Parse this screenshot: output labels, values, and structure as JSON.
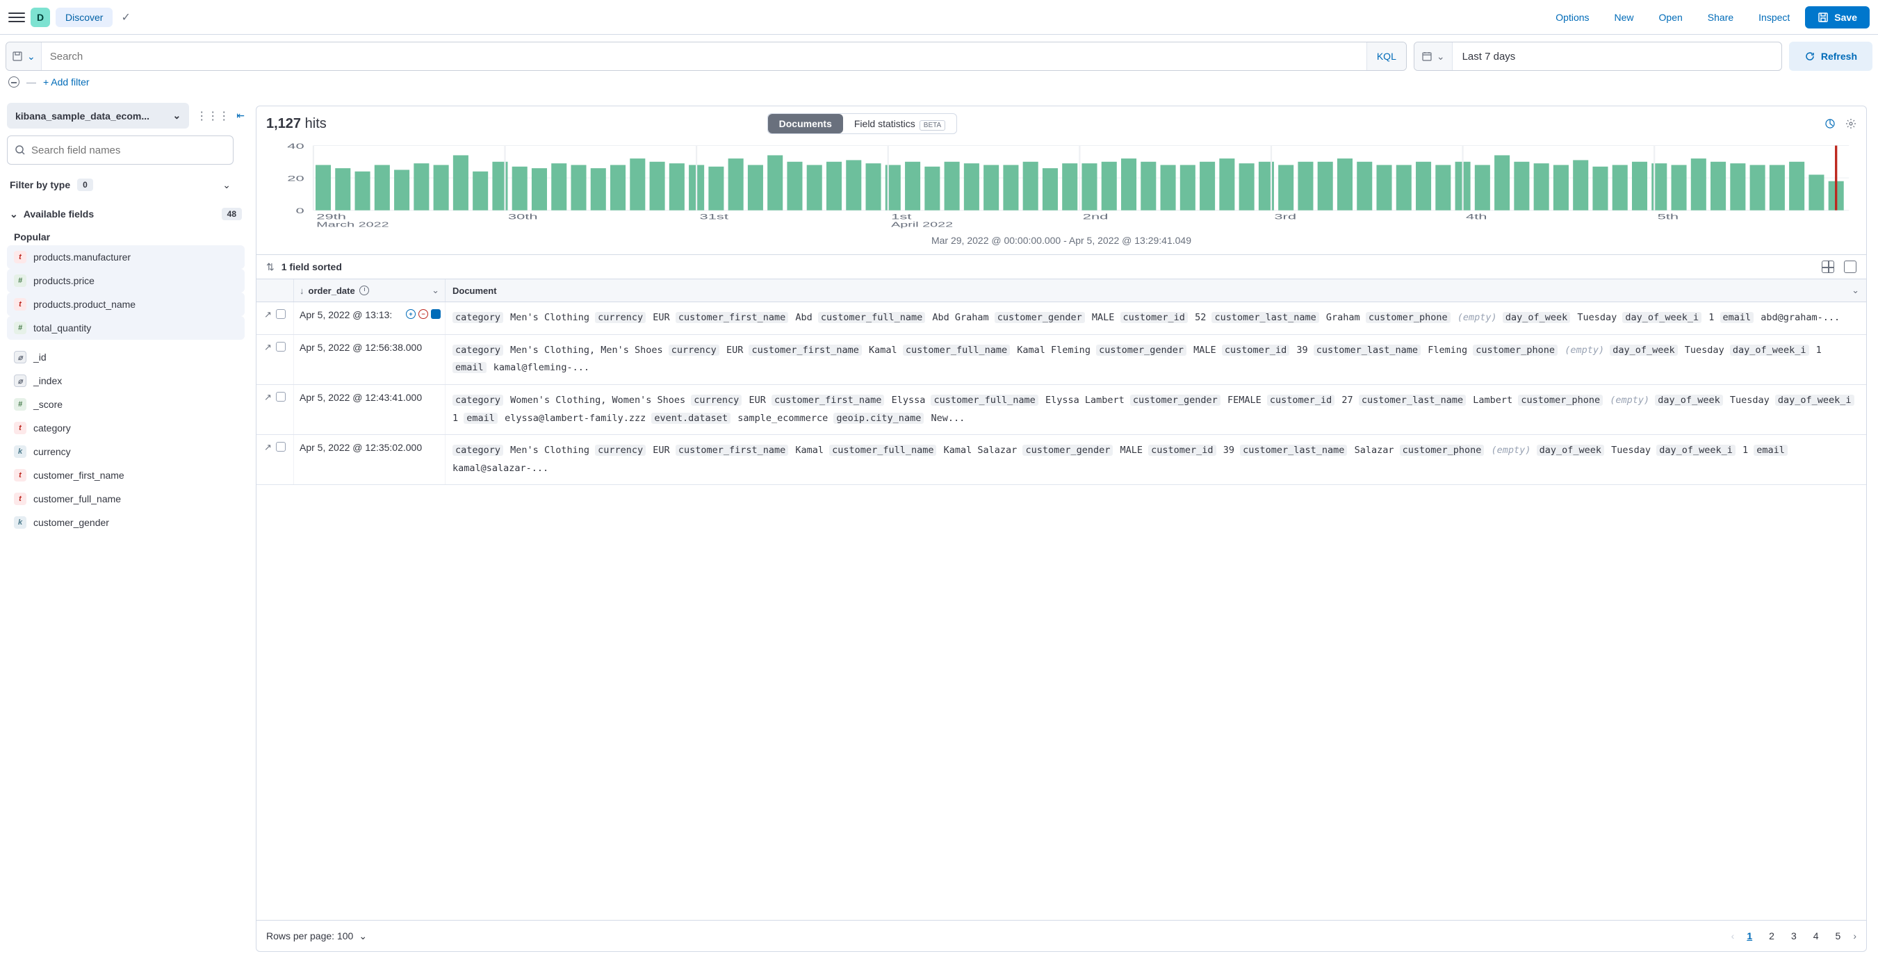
{
  "header": {
    "avatar_letter": "D",
    "app_name": "Discover",
    "links": [
      "Options",
      "New",
      "Open",
      "Share",
      "Inspect"
    ],
    "save_label": "Save"
  },
  "querybar": {
    "search_placeholder": "Search",
    "kql_label": "KQL",
    "date_text": "Last 7 days",
    "refresh_label": "Refresh"
  },
  "filters": {
    "add_filter_label": "+ Add filter"
  },
  "sidebar": {
    "datasource": "kibana_sample_data_ecom...",
    "field_search_placeholder": "Search field names",
    "filter_by_type_label": "Filter by type",
    "filter_by_type_count": "0",
    "available_fields_label": "Available fields",
    "available_fields_count": "48",
    "popular_label": "Popular",
    "popular_fields": [
      {
        "type": "t",
        "name": "products.manufacturer"
      },
      {
        "type": "n",
        "name": "products.price"
      },
      {
        "type": "t",
        "name": "products.product_name"
      },
      {
        "type": "n",
        "name": "total_quantity"
      }
    ],
    "fields": [
      {
        "type": "id",
        "name": "_id"
      },
      {
        "type": "id",
        "name": "_index"
      },
      {
        "type": "n",
        "name": "_score"
      },
      {
        "type": "t",
        "name": "category"
      },
      {
        "type": "k",
        "name": "currency"
      },
      {
        "type": "t",
        "name": "customer_first_name"
      },
      {
        "type": "t",
        "name": "customer_full_name"
      },
      {
        "type": "k",
        "name": "customer_gender"
      }
    ]
  },
  "results": {
    "hits_count": "1,127",
    "hits_label": "hits",
    "tabs": {
      "documents": "Documents",
      "stats": "Field statistics",
      "beta": "BETA"
    },
    "chart_caption": "Mar 29, 2022 @ 00:00:00.000 - Apr 5, 2022 @ 13:29:41.049",
    "sorted_label": "1 field sorted",
    "columns": {
      "date": "order_date",
      "doc": "Document"
    },
    "rows_per_page_label": "Rows per page: 100",
    "pages": [
      "1",
      "2",
      "3",
      "4",
      "5"
    ],
    "rows": [
      {
        "date": "Apr 5, 2022 @ 13:13:",
        "show_actions": true,
        "fields": [
          {
            "k": "category",
            "v": "Men's Clothing"
          },
          {
            "k": "currency",
            "v": "EUR"
          },
          {
            "k": "customer_first_name",
            "v": "Abd"
          },
          {
            "k": "customer_full_name",
            "v": "Abd Graham"
          },
          {
            "k": "customer_gender",
            "v": "MALE"
          },
          {
            "k": "customer_id",
            "v": "52"
          },
          {
            "k": "customer_last_name",
            "v": "Graham"
          },
          {
            "k": "customer_phone",
            "v": "(empty)",
            "empty": true
          },
          {
            "k": "day_of_week",
            "v": "Tuesday"
          },
          {
            "k": "day_of_week_i",
            "v": "1"
          },
          {
            "k": "email",
            "v": "abd@graham-..."
          }
        ]
      },
      {
        "date": "Apr 5, 2022 @ 12:56:38.000",
        "fields": [
          {
            "k": "category",
            "v": "Men's Clothing, Men's Shoes"
          },
          {
            "k": "currency",
            "v": "EUR"
          },
          {
            "k": "customer_first_name",
            "v": "Kamal"
          },
          {
            "k": "customer_full_name",
            "v": "Kamal Fleming"
          },
          {
            "k": "customer_gender",
            "v": "MALE"
          },
          {
            "k": "customer_id",
            "v": "39"
          },
          {
            "k": "customer_last_name",
            "v": "Fleming"
          },
          {
            "k": "customer_phone",
            "v": "(empty)",
            "empty": true
          },
          {
            "k": "day_of_week",
            "v": "Tuesday"
          },
          {
            "k": "day_of_week_i",
            "v": "1"
          },
          {
            "k": "email",
            "v": "kamal@fleming-..."
          }
        ]
      },
      {
        "date": "Apr 5, 2022 @ 12:43:41.000",
        "fields": [
          {
            "k": "category",
            "v": "Women's Clothing, Women's Shoes"
          },
          {
            "k": "currency",
            "v": "EUR"
          },
          {
            "k": "customer_first_name",
            "v": "Elyssa"
          },
          {
            "k": "customer_full_name",
            "v": "Elyssa Lambert"
          },
          {
            "k": "customer_gender",
            "v": "FEMALE"
          },
          {
            "k": "customer_id",
            "v": "27"
          },
          {
            "k": "customer_last_name",
            "v": "Lambert"
          },
          {
            "k": "customer_phone",
            "v": "(empty)",
            "empty": true
          },
          {
            "k": "day_of_week",
            "v": "Tuesday"
          },
          {
            "k": "day_of_week_i",
            "v": "1"
          },
          {
            "k": "email",
            "v": "elyssa@lambert-family.zzz"
          },
          {
            "k": "event.dataset",
            "v": "sample_ecommerce"
          },
          {
            "k": "geoip.city_name",
            "v": "New..."
          }
        ]
      },
      {
        "date": "Apr 5, 2022 @ 12:35:02.000",
        "fields": [
          {
            "k": "category",
            "v": "Men's Clothing"
          },
          {
            "k": "currency",
            "v": "EUR"
          },
          {
            "k": "customer_first_name",
            "v": "Kamal"
          },
          {
            "k": "customer_full_name",
            "v": "Kamal Salazar"
          },
          {
            "k": "customer_gender",
            "v": "MALE"
          },
          {
            "k": "customer_id",
            "v": "39"
          },
          {
            "k": "customer_last_name",
            "v": "Salazar"
          },
          {
            "k": "customer_phone",
            "v": "(empty)",
            "empty": true
          },
          {
            "k": "day_of_week",
            "v": "Tuesday"
          },
          {
            "k": "day_of_week_i",
            "v": "1"
          },
          {
            "k": "email",
            "v": "kamal@salazar-..."
          }
        ]
      }
    ]
  },
  "chart_data": {
    "type": "bar",
    "ylabel": "",
    "ylim": [
      0,
      40
    ],
    "yticks": [
      0,
      20,
      40
    ],
    "x_ticks": [
      {
        "label": "29th",
        "sub": "March 2022"
      },
      {
        "label": "30th"
      },
      {
        "label": "31st"
      },
      {
        "label": "1st",
        "sub": "April 2022"
      },
      {
        "label": "2nd"
      },
      {
        "label": "3rd"
      },
      {
        "label": "4th"
      },
      {
        "label": "5th"
      }
    ],
    "values": [
      28,
      26,
      24,
      28,
      25,
      29,
      28,
      34,
      24,
      30,
      27,
      26,
      29,
      28,
      26,
      28,
      32,
      30,
      29,
      28,
      27,
      32,
      28,
      34,
      30,
      28,
      30,
      31,
      29,
      28,
      30,
      27,
      30,
      29,
      28,
      28,
      30,
      26,
      29,
      29,
      30,
      32,
      30,
      28,
      28,
      30,
      32,
      29,
      30,
      28,
      30,
      30,
      32,
      30,
      28,
      28,
      30,
      28,
      30,
      28,
      34,
      30,
      29,
      28,
      31,
      27,
      28,
      30,
      29,
      28,
      32,
      30,
      29,
      28,
      28,
      30,
      22,
      18
    ],
    "marker_index": 77
  }
}
